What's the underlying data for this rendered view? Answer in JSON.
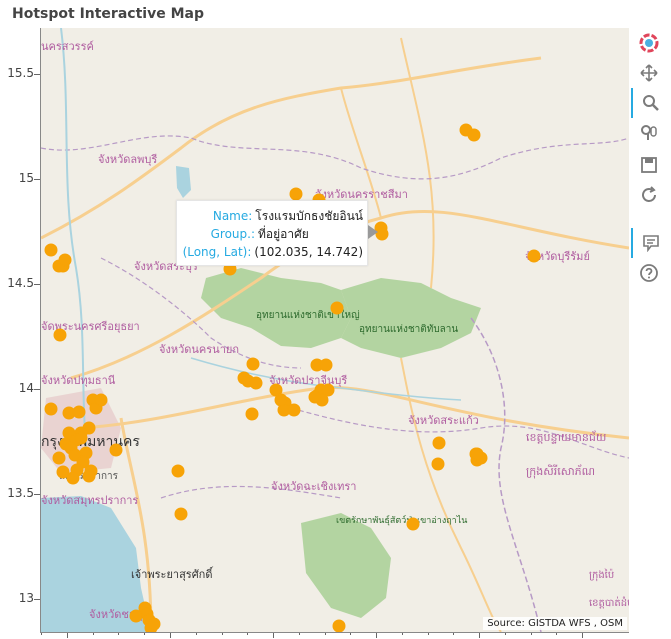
{
  "title": "Hotspot Interactive Map",
  "attribution": "Source: GISTDA WFS , OSM",
  "y_ticks": [
    "15.5",
    "15",
    "14.5",
    "14",
    "13.5",
    "13"
  ],
  "map_labels": [
    {
      "text": "นครสวรรค์",
      "cls": "prov"
    },
    {
      "text": "จังหวัดลพบุรี",
      "cls": "prov"
    },
    {
      "text": "จังหวัดนครราชสีมา",
      "cls": "prov"
    },
    {
      "text": "จังหวัดบุรีรัมย์",
      "cls": "prov"
    },
    {
      "text": "จังหวัดสระบุรี",
      "cls": "prov"
    },
    {
      "text": "อุทยานแห่งชาติเขาใหญ่",
      "cls": "park"
    },
    {
      "text": "อุทยานแห่งชาติทับลาน",
      "cls": "park"
    },
    {
      "text": "จัดพระนครศรีอยุธยา",
      "cls": "prov"
    },
    {
      "text": "จังหวัดนครนายก",
      "cls": "prov"
    },
    {
      "text": "จังหวัดปทุมธานี",
      "cls": "prov"
    },
    {
      "text": "จังหวัดปราจีนบุรี",
      "cls": "prov"
    },
    {
      "text": "กรุงเทพมหานคร",
      "cls": "city"
    },
    {
      "text": "สมุทรปราการ",
      "cls": "city"
    },
    {
      "text": "จังหวัดสมุทรปราการ",
      "cls": "prov"
    },
    {
      "text": "จังหวัดสระแก้ว",
      "cls": "prov"
    },
    {
      "text": "ខេត្តបន្ទាយមានជ័យ",
      "cls": "prov"
    },
    {
      "text": "ក្រុងសិរីសោភ័ណ",
      "cls": "prov"
    },
    {
      "text": "จังหวัดฉะเชิงเทรา",
      "cls": "prov"
    },
    {
      "text": "เจ้าพระยาสุรศักดิ์",
      "cls": "city"
    },
    {
      "text": "เขตรักษาพันธุ์สัตว์ป่าเขาอ่างฤาไน",
      "cls": "park"
    },
    {
      "text": "จังหวัดชลบุรี",
      "cls": "prov"
    },
    {
      "text": "ក្រុងប៉ៃ",
      "cls": "prov"
    },
    {
      "text": "ខេត្តបាត់ដំបង",
      "cls": "prov"
    }
  ],
  "tooltip": {
    "name_label": "Name:",
    "name_value": "โรงแรมบักธงชัยอินน์",
    "group_label": "Group.:",
    "group_value": "ที่อยู่อาศัย",
    "coord_label": "(Long, Lat):",
    "coord_value": "(102.035, 14.742)"
  },
  "toolbar": {
    "tools": [
      "bokeh-logo-icon",
      "pan-icon",
      "zoom-icon",
      "wheel-zoom-icon",
      "save-icon",
      "reset-icon",
      "hover-icon",
      "help-icon"
    ]
  },
  "colors": {
    "point": "#f7a307",
    "park": "#a8cf94",
    "water": "#aad3df",
    "land": "#f1eee6",
    "accent": "#26aae1"
  },
  "points_count": 70
}
